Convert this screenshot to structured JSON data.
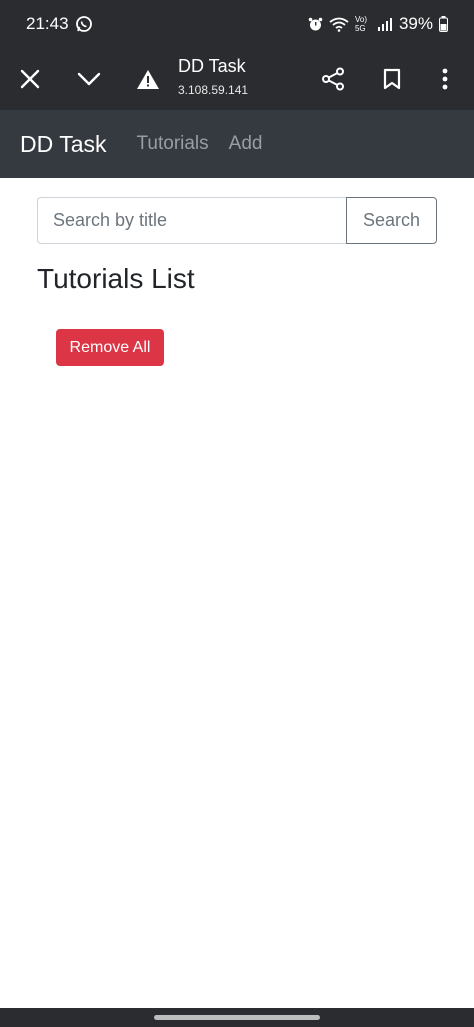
{
  "status_bar": {
    "time": "21:43",
    "battery_percent": "39%",
    "network_label": "Vo) 5G"
  },
  "browser": {
    "title": "DD Task",
    "url": "3.108.59.141"
  },
  "app_nav": {
    "brand": "DD Task",
    "links": [
      "Tutorials",
      "Add"
    ]
  },
  "search": {
    "placeholder": "Search by title",
    "value": "",
    "button_label": "Search"
  },
  "list": {
    "heading": "Tutorials List",
    "remove_all_label": "Remove All"
  },
  "colors": {
    "system_bar": "#2b2c30",
    "app_navbar": "#343a40",
    "danger": "#dc3545"
  }
}
